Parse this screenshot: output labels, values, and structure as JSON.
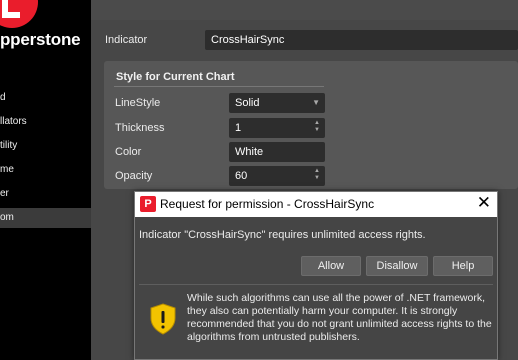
{
  "sidebar": {
    "logo_text": "pperstone",
    "items": [
      "d",
      "llators",
      "tility",
      "me",
      "er",
      "om"
    ],
    "active_item": "om"
  },
  "indicator": {
    "label": "Indicator",
    "value": "CrossHairSync"
  },
  "style": {
    "title": "Style for Current Chart",
    "line_style_label": "LineStyle",
    "line_style_value": "Solid",
    "thickness_label": "Thickness",
    "thickness_value": "1",
    "color_label": "Color",
    "color_value": "White",
    "opacity_label": "Opacity",
    "opacity_value": "60"
  },
  "dialog": {
    "title": "Request for permission - CrossHairSync",
    "close_icon": "close-icon",
    "message": "Indicator \"CrossHairSync\" requires unlimited access rights.",
    "allow_label": "Allow",
    "disallow_label": "Disallow",
    "help_label": "Help",
    "warning_icon": "shield-icon",
    "warning_text": "While such algorithms can use all the power of .NET framework, they also can potentially harm your computer. It is strongly recommended that you do not grant unlimited access rights to the algorithms from untrusted publishers."
  },
  "colors": {
    "brand": "#ea1d2c",
    "panel": "#474747",
    "field": "#2d2d2d",
    "shield_yellow": "#f3c300"
  }
}
